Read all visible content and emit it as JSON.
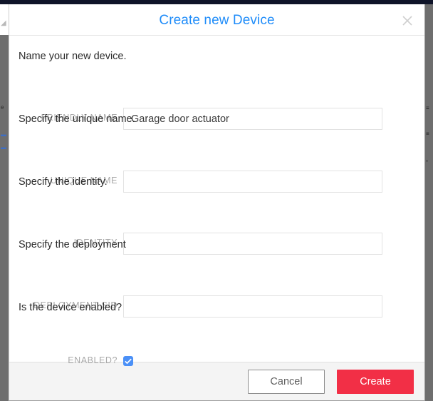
{
  "window": {
    "topbar_color": "#0f1429",
    "backdrop_color": "#6e6e6e",
    "left_peek_mark": "◢",
    "left_ghost_1": "e",
    "left_ghost_2": "▬",
    "left_ghost_3": "▬",
    "right_ghost_1": "≡",
    "right_ghost_2": "≡",
    "right_ghost_3": "▫"
  },
  "modal": {
    "title": "Create new Device",
    "title_color": "#1f8cf9",
    "close_icon": "close-icon",
    "sections": [
      {
        "prompt": "Name your new device.",
        "label": "FRIENDLY NAME",
        "value": "Garage door actuator",
        "placeholder": ""
      },
      {
        "prompt": "Specify the unique name.",
        "label": "UNIQUE NAME",
        "value": "",
        "placeholder": ""
      },
      {
        "prompt": "Specify the identity.",
        "label": "IDENTITY",
        "value": "",
        "placeholder": ""
      },
      {
        "prompt": "Specify the deployment",
        "label": "DEPLOYMENT SID",
        "value": "",
        "placeholder": ""
      }
    ],
    "enabled_section": {
      "prompt": "Is the device enabled?",
      "label": "ENABLED?",
      "checked": true,
      "checkbox_color": "#4b90f7"
    },
    "footer": {
      "cancel_label": "Cancel",
      "create_label": "Create",
      "create_color": "#f22f46",
      "background": "#f4f4f4"
    }
  }
}
